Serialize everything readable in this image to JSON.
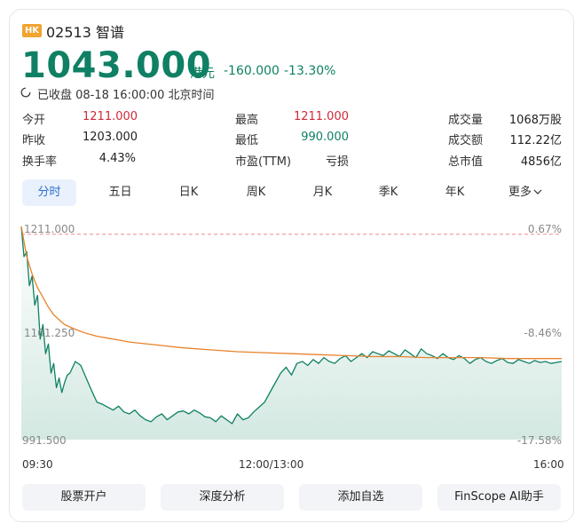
{
  "header": {
    "market_badge": "HK",
    "code_name": "02513 智谱",
    "price": "1043.000",
    "currency": "港元",
    "change": "-160.000",
    "change_pct": "-13.30%",
    "status": "已收盘 08-18 16:00:00 北京时间",
    "status_icon": "clock-icon"
  },
  "stats": {
    "open_label": "今开",
    "open_value": "1211.000",
    "prev_close_label": "昨收",
    "prev_close_value": "1203.000",
    "turnover_rate_label": "换手率",
    "turnover_rate_value": "4.43%",
    "high_label": "最高",
    "high_value": "1211.000",
    "low_label": "最低",
    "low_value": "990.000",
    "pe_label": "市盈(TTM)",
    "pe_value": "亏损",
    "volume_label": "成交量",
    "volume_value": "1068万股",
    "amount_label": "成交额",
    "amount_value": "112.22亿",
    "mktcap_label": "总市值",
    "mktcap_value": "4856亿"
  },
  "tabs": [
    "分时",
    "五日",
    "日K",
    "周K",
    "月K",
    "季K",
    "年K",
    "更多"
  ],
  "active_tab": "分时",
  "buttons": [
    "股票开户",
    "深度分析",
    "添加自选",
    "FinScope AI助手"
  ],
  "colors": {
    "down_green": "#0f8063",
    "up_red": "#d0283a",
    "avg_line": "#e8822a",
    "prev_close_line": "#f08c8c",
    "badge": "#f0a431",
    "active_tab": "#2f6fd1"
  },
  "chart_data": {
    "type": "line",
    "y_left_ticks": [
      "1211.000",
      "1101.250",
      "991.500"
    ],
    "y_right_ticks": [
      "0.67%",
      "-8.46%",
      "-17.58%"
    ],
    "x_ticks": [
      "09:30",
      "12:00/13:00",
      "16:00"
    ],
    "ylim": [
      991.5,
      1211.0
    ],
    "prev_close": 1203.0,
    "xlim": [
      0,
      100
    ],
    "series": [
      {
        "key": "price",
        "x": [
          0,
          0.5,
          1,
          1.5,
          2,
          2.5,
          3,
          3.5,
          4,
          4.5,
          5,
          5.5,
          6,
          6.5,
          7,
          7.5,
          8,
          8.5,
          9,
          10,
          11,
          12,
          13,
          14,
          15,
          16,
          17,
          18,
          19,
          20,
          21,
          22,
          23,
          24,
          25,
          26,
          27,
          28,
          29,
          30,
          31,
          32,
          33,
          34,
          35,
          36,
          37,
          38,
          39,
          40,
          41,
          42,
          43,
          44,
          45,
          46,
          47,
          48,
          49,
          50,
          51,
          52,
          53,
          54,
          55,
          56,
          57,
          58,
          59,
          60,
          61,
          62,
          63,
          64,
          65,
          66,
          67,
          68,
          69,
          70,
          71,
          72,
          73,
          74,
          75,
          76,
          77,
          78,
          79,
          80,
          81,
          82,
          83,
          84,
          85,
          86,
          87,
          88,
          89,
          90,
          91,
          92,
          93,
          94,
          95,
          96,
          97,
          98,
          99,
          100
        ],
        "values": [
          1211,
          1180,
          1185,
          1150,
          1160,
          1130,
          1140,
          1095,
          1110,
          1080,
          1090,
          1060,
          1070,
          1045,
          1055,
          1040,
          1050,
          1058,
          1060,
          1072,
          1068,
          1055,
          1042,
          1030,
          1028,
          1025,
          1022,
          1026,
          1020,
          1018,
          1022,
          1016,
          1012,
          1010,
          1015,
          1018,
          1012,
          1016,
          1020,
          1021,
          1018,
          1022,
          1019,
          1015,
          1014,
          1010,
          1016,
          1012,
          1008,
          1018,
          1012,
          1014,
          1020,
          1025,
          1030,
          1040,
          1050,
          1060,
          1066,
          1058,
          1070,
          1072,
          1068,
          1074,
          1070,
          1076,
          1072,
          1070,
          1075,
          1078,
          1072,
          1076,
          1080,
          1076,
          1082,
          1080,
          1078,
          1083,
          1080,
          1077,
          1084,
          1080,
          1076,
          1085,
          1080,
          1078,
          1075,
          1080,
          1076,
          1074,
          1078,
          1075,
          1070,
          1074,
          1076,
          1072,
          1070,
          1073,
          1075,
          1071,
          1070,
          1074,
          1072,
          1070,
          1073,
          1071,
          1072,
          1070,
          1071,
          1072
        ]
      },
      {
        "key": "average",
        "x": [
          0,
          1,
          2,
          3,
          4,
          5,
          6,
          7,
          8,
          10,
          12,
          14,
          16,
          18,
          20,
          25,
          30,
          35,
          40,
          45,
          50,
          55,
          60,
          65,
          70,
          75,
          80,
          85,
          90,
          95,
          100
        ],
        "values": [
          1211,
          1180,
          1162,
          1148,
          1138,
          1128,
          1120,
          1115,
          1110,
          1105,
          1101,
          1098,
          1096,
          1094,
          1092,
          1089,
          1086,
          1084,
          1082,
          1081,
          1080,
          1079,
          1078,
          1077,
          1077,
          1076,
          1076,
          1076,
          1075,
          1075,
          1075
        ]
      }
    ]
  }
}
